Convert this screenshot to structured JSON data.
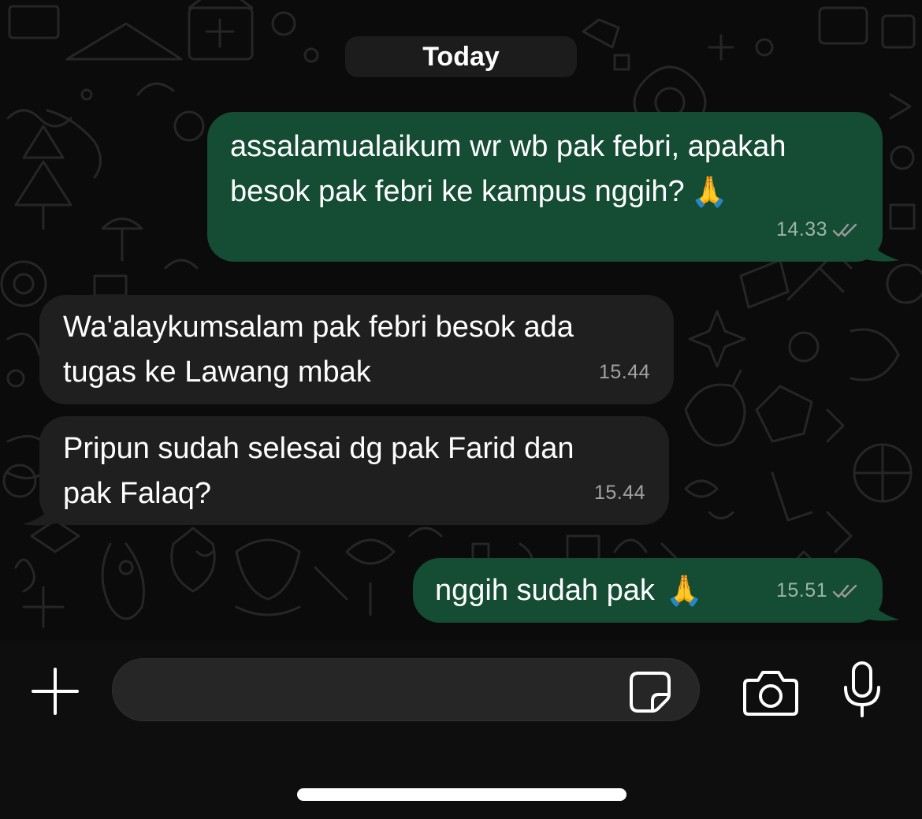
{
  "chat": {
    "date_label": "Today",
    "messages": [
      {
        "direction": "outgoing",
        "lines": [
          "assalamualaikum wr wb pak febri, apakah",
          "besok pak febri ke kampus nggih?"
        ],
        "emoji": "🙏",
        "time": "14.33",
        "status": "read"
      },
      {
        "direction": "incoming",
        "lines": [
          "Wa'alaykumsalam pak febri besok ada",
          "tugas ke Lawang mbak"
        ],
        "time": "15.44"
      },
      {
        "direction": "incoming",
        "lines": [
          "Pripun sudah selesai dg pak Farid dan",
          "pak Falaq?"
        ],
        "time": "15.44"
      },
      {
        "direction": "outgoing",
        "lines": [
          "nggih sudah pak"
        ],
        "emoji": "🙏",
        "time": "15.51",
        "status": "read"
      }
    ]
  },
  "input_bar": {
    "message_placeholder": "",
    "icons": [
      "plus-icon",
      "sticker-icon",
      "camera-icon",
      "microphone-icon"
    ]
  },
  "colors": {
    "background": "#0b0b0b",
    "outgoing_bubble": "#144c34",
    "incoming_bubble": "#1f1f1f",
    "text": "#ffffff",
    "timestamp": "#9a9a9a"
  }
}
